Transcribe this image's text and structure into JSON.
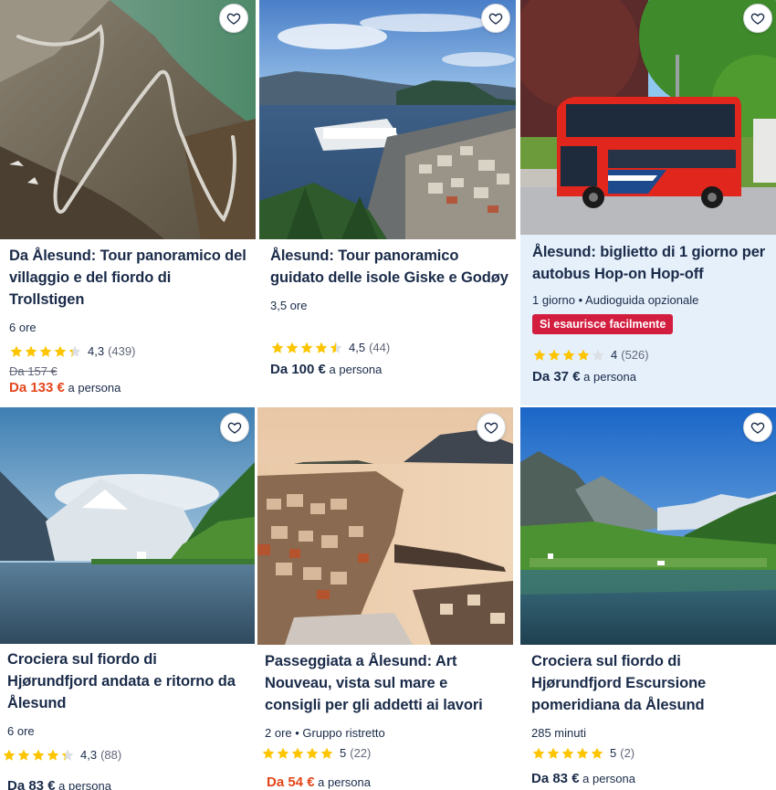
{
  "cards": [
    {
      "title": "Da Ålesund: Tour panoramico del villaggio e del fiordo di Trollstigen",
      "meta": "6 ore",
      "badge": "",
      "rating_value": "4,3",
      "rating_count": "(439)",
      "stars": 4.3,
      "old_price": "Da 157 €",
      "price": "Da 133 €",
      "price_suffix": "a persona",
      "sale": true,
      "image": "mountain-serpentine-road"
    },
    {
      "title": "Ålesund: Tour panoramico guidato delle isole Giske e Godøy",
      "meta": "3,5 ore",
      "badge": "",
      "rating_value": "4,5",
      "rating_count": "(44)",
      "stars": 4.5,
      "old_price": "",
      "price": "Da 100 €",
      "price_suffix": "a persona",
      "sale": false,
      "image": "harbour-city-view"
    },
    {
      "title": "Ålesund: biglietto di 1 giorno per autobus Hop-on Hop-off",
      "meta": "1 giorno • Audioguida opzionale",
      "badge": "Si esaurisce facilmente",
      "rating_value": "4",
      "rating_count": "(526)",
      "stars": 4.0,
      "old_price": "",
      "price": "Da 37 €",
      "price_suffix": "a persona",
      "sale": false,
      "image": "red-double-decker-bus"
    },
    {
      "title": "Crociera sul fiordo di Hjørundfjord andata e ritorno da Ålesund",
      "meta": "6 ore",
      "badge": "",
      "rating_value": "4,3",
      "rating_count": "(88)",
      "stars": 4.3,
      "old_price": "",
      "price": "Da 83 €",
      "price_suffix": "a persona",
      "sale": false,
      "image": "fjord-snowy-peaks"
    },
    {
      "title": "Passeggiata a Ålesund: Art Nouveau, vista sul mare e consigli per gli addetti ai lavori",
      "meta": "2 ore • Gruppo ristretto",
      "badge": "",
      "rating_value": "5",
      "rating_count": "(22)",
      "stars": 5,
      "old_price": "",
      "price": "Da 54 €",
      "price_suffix": "a persona",
      "sale": true,
      "image": "old-town-sunset"
    },
    {
      "title": "Crociera sul fiordo di Hjørundfjord Escursione pomeridiana da Ålesund",
      "meta": "285 minuti",
      "badge": "",
      "rating_value": "5",
      "rating_count": "(2)",
      "stars": 5,
      "old_price": "",
      "price": "Da 83 €",
      "price_suffix": "a persona",
      "sale": false,
      "image": "fjord-green-valley"
    }
  ],
  "colors": {
    "star": "#fdc500",
    "star_empty": "#dcdfe4",
    "sale_price": "#e4461a",
    "badge_bg": "#d21d3f",
    "text": "#1a2b49",
    "highlight_bg": "#e6f0fb"
  },
  "icons": {
    "wishlist": "heart-outline-icon",
    "rating": "star-icon"
  }
}
